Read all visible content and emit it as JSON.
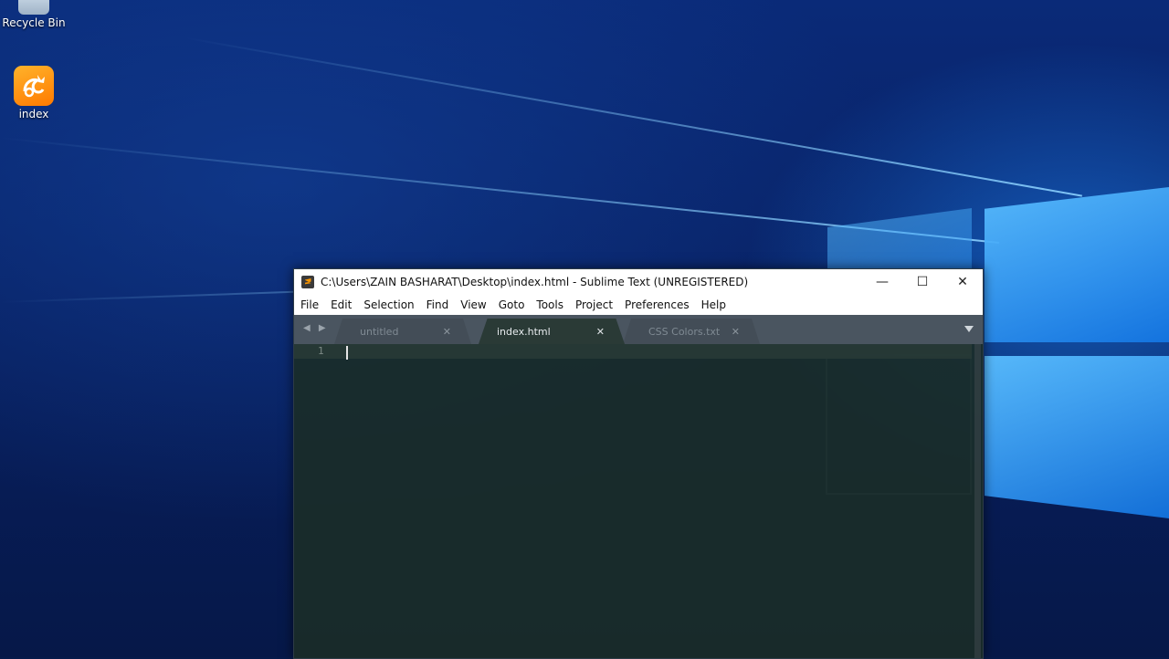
{
  "desktop": {
    "icons": [
      {
        "label": "Recycle Bin"
      },
      {
        "label": "index"
      }
    ]
  },
  "window": {
    "title": "C:\\Users\\ZAIN BASHARAT\\Desktop\\index.html - Sublime Text (UNREGISTERED)",
    "controls": {
      "minimize": "—",
      "maximize": "☐",
      "close": "✕"
    },
    "menu": [
      "File",
      "Edit",
      "Selection",
      "Find",
      "View",
      "Goto",
      "Tools",
      "Project",
      "Preferences",
      "Help"
    ],
    "tab_nav": "◀ ▶",
    "tabs": [
      {
        "label": "untitled",
        "active": false
      },
      {
        "label": "index.html",
        "active": true
      },
      {
        "label": "CSS Colors.txt",
        "active": false
      }
    ],
    "tab_close": "✕",
    "editor": {
      "line_number": "1"
    }
  }
}
